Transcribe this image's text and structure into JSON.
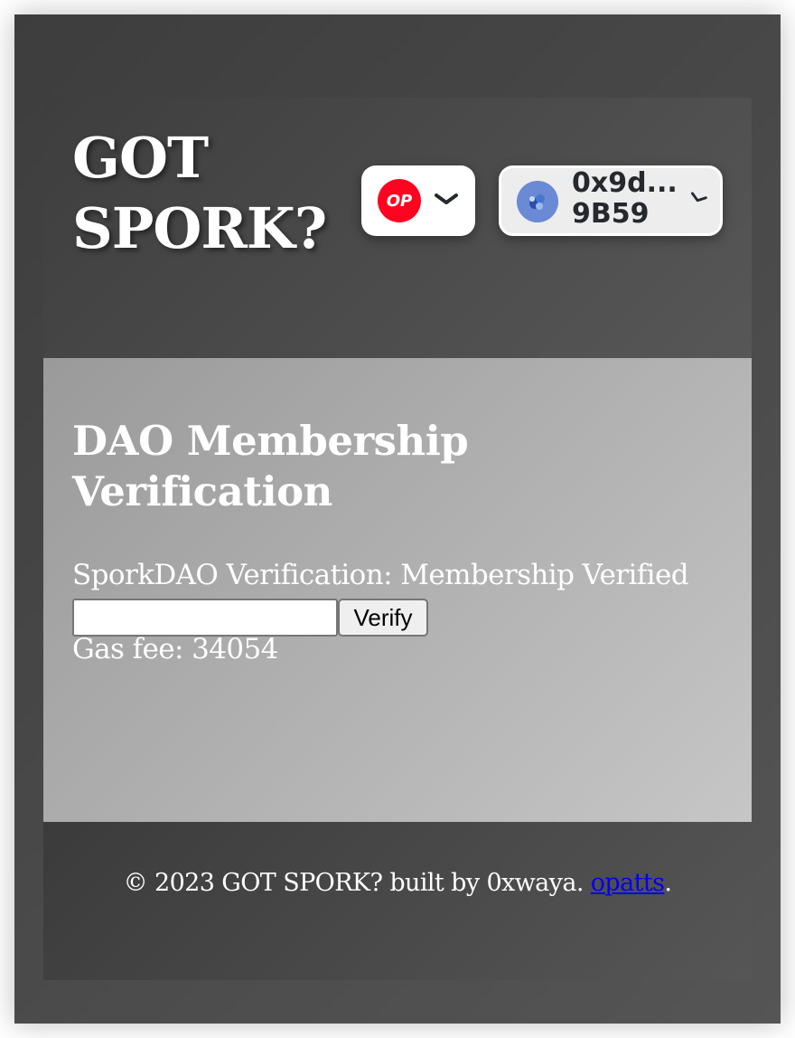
{
  "header": {
    "logo_text": "GOT\nSPORK?",
    "chain": {
      "badge_text": "OP",
      "icon": "optimism-logo-icon",
      "color": "#ff0420"
    },
    "account": {
      "address": "0x9d...\n9B59",
      "avatar_icon": "avatar-icon"
    }
  },
  "main": {
    "title": "DAO Membership\nVerification",
    "status": "SporkDAO Verification: Membership Verified",
    "input_value": "",
    "verify_label": "Verify",
    "gas_fee": "Gas fee: 34054"
  },
  "footer": {
    "prefix": "© 2023 GOT SPORK? built by 0xwaya. ",
    "link": "opatts",
    "suffix": "."
  }
}
